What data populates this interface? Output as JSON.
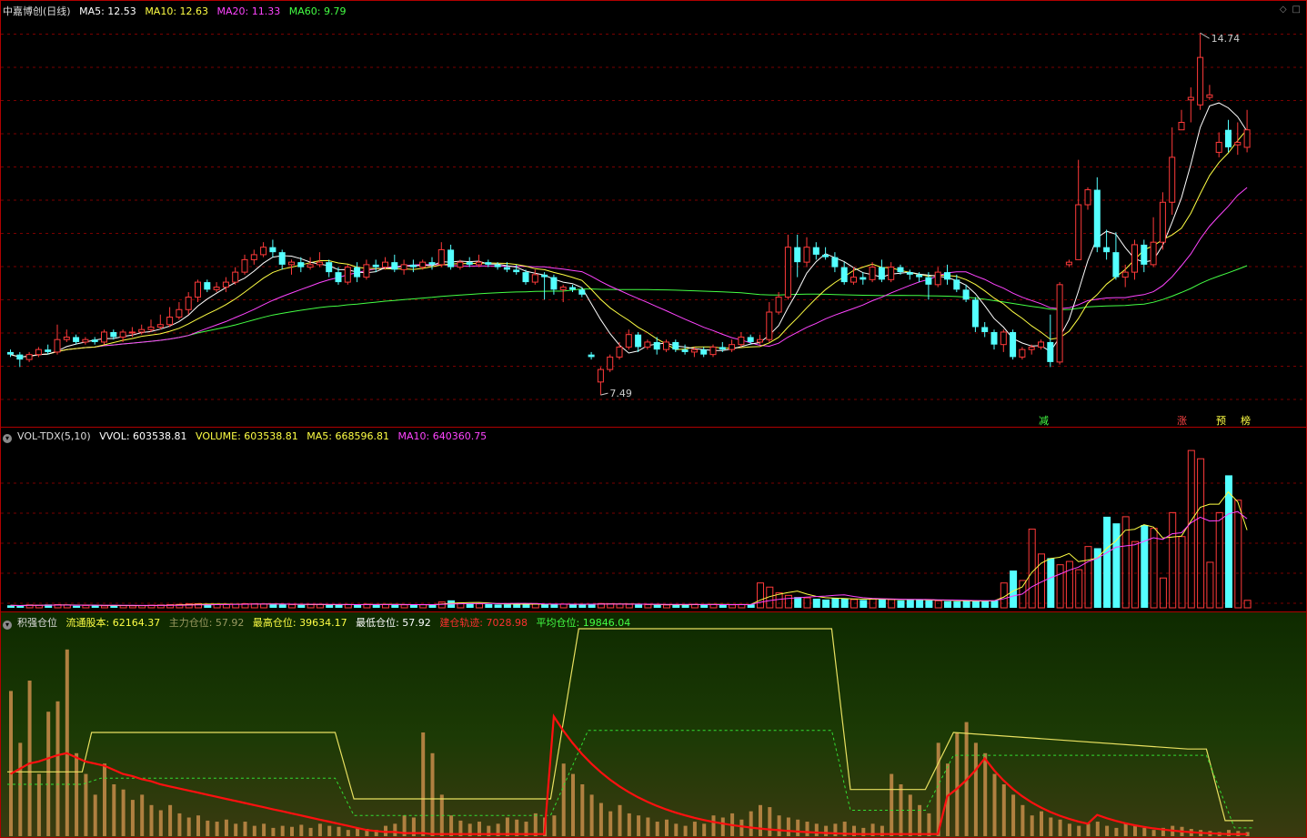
{
  "price": {
    "title": "中嘉博创(日线)",
    "ma": [
      {
        "label": "MA5: 12.53",
        "color": "#ffffff"
      },
      {
        "label": "MA10: 12.63",
        "color": "#ffff44"
      },
      {
        "label": "MA20: 11.33",
        "color": "#ff44ff"
      },
      {
        "label": "MA60: 9.79",
        "color": "#44ff44"
      }
    ],
    "high_label": "14.74",
    "low_label": "7.49",
    "signals": {
      "jian": "减",
      "zhang": "涨",
      "yu": "预",
      "bang": "榜"
    }
  },
  "volume": {
    "title": "VOL-TDX(5,10)",
    "vvol": "VVOL: 603538.81",
    "volume": "VOLUME: 603538.81",
    "ma5": "MA5: 668596.81",
    "ma10": "MA10: 640360.75"
  },
  "position": {
    "title": "积强仓位",
    "float_shares": "流通股本: 62164.37",
    "main_pos": "主力仓位: 57.92",
    "max_pos": "最高仓位: 39634.17",
    "min_pos": "最低仓位: 57.92",
    "build_track": "建仓轨迹: 7028.98",
    "avg_pos": "平均仓位: 19846.04"
  },
  "colors": {
    "up": "#ff3a3a",
    "down": "#54ffff",
    "grid": "#7a0000",
    "ma5": "#ffffff",
    "ma10": "#ffff44",
    "ma20": "#ff44ff",
    "ma60": "#44ff44"
  },
  "candles": [
    [
      8.35,
      8.3,
      8.4,
      8.25
    ],
    [
      8.3,
      8.2,
      8.35,
      8.05
    ],
    [
      8.2,
      8.3,
      8.35,
      8.15
    ],
    [
      8.3,
      8.4,
      8.45,
      8.25
    ],
    [
      8.4,
      8.35,
      8.5,
      8.3
    ],
    [
      8.35,
      8.6,
      8.9,
      8.3
    ],
    [
      8.6,
      8.65,
      8.8,
      8.55
    ],
    [
      8.65,
      8.55,
      8.7,
      8.5
    ],
    [
      8.55,
      8.6,
      8.65,
      8.5
    ],
    [
      8.6,
      8.55,
      8.65,
      8.5
    ],
    [
      8.55,
      8.75,
      8.8,
      8.5
    ],
    [
      8.75,
      8.65,
      8.8,
      8.6
    ],
    [
      8.65,
      8.75,
      8.8,
      8.55
    ],
    [
      8.75,
      8.75,
      8.85,
      8.65
    ],
    [
      8.75,
      8.8,
      8.9,
      8.7
    ],
    [
      8.8,
      8.85,
      9.0,
      8.75
    ],
    [
      8.85,
      8.9,
      9.1,
      8.8
    ],
    [
      8.9,
      9.05,
      9.25,
      8.85
    ],
    [
      9.05,
      9.2,
      9.35,
      9.0
    ],
    [
      9.2,
      9.45,
      9.55,
      9.1
    ],
    [
      9.45,
      9.75,
      9.8,
      9.35
    ],
    [
      9.75,
      9.6,
      9.8,
      9.55
    ],
    [
      9.6,
      9.65,
      9.75,
      9.55
    ],
    [
      9.65,
      9.75,
      9.85,
      9.55
    ],
    [
      9.75,
      9.95,
      10.05,
      9.7
    ],
    [
      9.95,
      10.2,
      10.3,
      9.9
    ],
    [
      10.2,
      10.3,
      10.4,
      10.1
    ],
    [
      10.3,
      10.45,
      10.55,
      10.25
    ],
    [
      10.45,
      10.35,
      10.6,
      10.25
    ],
    [
      10.35,
      10.1,
      10.4,
      10.0
    ],
    [
      10.1,
      10.15,
      10.2,
      9.9
    ],
    [
      10.15,
      10.05,
      10.25,
      9.95
    ],
    [
      10.05,
      10.1,
      10.25,
      10.0
    ],
    [
      10.1,
      10.15,
      10.35,
      10.05
    ],
    [
      10.15,
      9.95,
      10.2,
      9.85
    ],
    [
      9.95,
      9.75,
      10.05,
      9.7
    ],
    [
      9.75,
      10.05,
      10.1,
      9.7
    ],
    [
      10.05,
      9.85,
      10.15,
      9.75
    ],
    [
      9.85,
      10.1,
      10.2,
      9.8
    ],
    [
      10.1,
      10.05,
      10.2,
      9.95
    ],
    [
      10.05,
      10.15,
      10.25,
      10.0
    ],
    [
      10.15,
      10.0,
      10.3,
      9.95
    ],
    [
      10.0,
      10.1,
      10.2,
      9.9
    ],
    [
      10.1,
      10.05,
      10.2,
      9.95
    ],
    [
      10.05,
      10.15,
      10.2,
      10.0
    ],
    [
      10.15,
      10.1,
      10.25,
      10.0
    ],
    [
      10.1,
      10.4,
      10.55,
      10.05
    ],
    [
      10.4,
      10.05,
      10.5,
      10.0
    ],
    [
      10.05,
      10.15,
      10.2,
      10.0
    ],
    [
      10.15,
      10.1,
      10.25,
      10.05
    ],
    [
      10.1,
      10.15,
      10.3,
      10.05
    ],
    [
      10.15,
      10.1,
      10.2,
      10.05
    ],
    [
      10.1,
      10.05,
      10.15,
      10.0
    ],
    [
      10.05,
      10.0,
      10.15,
      9.95
    ],
    [
      10.0,
      9.95,
      10.1,
      9.9
    ],
    [
      9.95,
      9.75,
      10.0,
      9.7
    ],
    [
      9.75,
      9.9,
      10.0,
      9.7
    ],
    [
      9.9,
      9.85,
      9.95,
      9.4
    ],
    [
      9.85,
      9.6,
      9.9,
      9.5
    ],
    [
      9.6,
      9.65,
      9.7,
      9.35
    ],
    [
      9.65,
      9.6,
      9.7,
      9.55
    ],
    [
      9.6,
      9.5,
      9.65,
      9.45
    ],
    [
      8.3,
      8.25,
      8.35,
      8.2
    ],
    [
      7.75,
      8.0,
      8.05,
      7.49
    ],
    [
      8.0,
      8.25,
      8.3,
      7.95
    ],
    [
      8.25,
      8.45,
      8.55,
      8.2
    ],
    [
      8.45,
      8.7,
      8.8,
      8.4
    ],
    [
      8.7,
      8.45,
      8.75,
      8.35
    ],
    [
      8.45,
      8.55,
      8.6,
      8.4
    ],
    [
      8.55,
      8.4,
      8.65,
      8.3
    ],
    [
      8.4,
      8.55,
      8.6,
      8.35
    ],
    [
      8.55,
      8.4,
      8.6,
      8.35
    ],
    [
      8.4,
      8.35,
      8.5,
      8.3
    ],
    [
      8.35,
      8.4,
      8.45,
      8.25
    ],
    [
      8.4,
      8.3,
      8.45,
      8.25
    ],
    [
      8.3,
      8.45,
      8.5,
      8.25
    ],
    [
      8.45,
      8.4,
      8.55,
      8.35
    ],
    [
      8.4,
      8.5,
      8.6,
      8.35
    ],
    [
      8.5,
      8.65,
      8.75,
      8.45
    ],
    [
      8.65,
      8.55,
      8.7,
      8.5
    ],
    [
      8.55,
      8.6,
      8.7,
      8.5
    ],
    [
      8.6,
      9.15,
      9.35,
      8.55
    ],
    [
      9.15,
      9.45,
      9.55,
      9.1
    ],
    [
      9.45,
      10.45,
      10.7,
      9.4
    ],
    [
      10.45,
      10.15,
      10.7,
      9.85
    ],
    [
      10.15,
      10.45,
      10.65,
      10.05
    ],
    [
      10.45,
      10.3,
      10.55,
      10.2
    ],
    [
      10.3,
      10.25,
      10.45,
      10.2
    ],
    [
      10.25,
      10.05,
      10.35,
      9.95
    ],
    [
      10.05,
      9.75,
      10.15,
      9.7
    ],
    [
      9.75,
      9.85,
      10.05,
      9.7
    ],
    [
      9.85,
      9.8,
      9.95,
      9.7
    ],
    [
      9.8,
      10.05,
      10.15,
      9.75
    ],
    [
      10.05,
      9.8,
      10.2,
      9.75
    ],
    [
      9.8,
      10.05,
      10.15,
      9.75
    ],
    [
      10.05,
      9.95,
      10.1,
      9.9
    ],
    [
      9.95,
      9.9,
      10.0,
      9.8
    ],
    [
      9.9,
      9.85,
      9.95,
      9.75
    ],
    [
      9.85,
      9.7,
      9.95,
      9.4
    ],
    [
      9.7,
      9.95,
      10.05,
      9.65
    ],
    [
      9.95,
      9.8,
      10.1,
      9.7
    ],
    [
      9.8,
      9.6,
      9.9,
      9.55
    ],
    [
      9.6,
      9.4,
      9.7,
      9.35
    ],
    [
      9.4,
      8.85,
      9.45,
      8.75
    ],
    [
      8.85,
      8.75,
      8.95,
      8.65
    ],
    [
      8.75,
      8.5,
      8.8,
      8.4
    ],
    [
      8.5,
      8.75,
      8.8,
      8.35
    ],
    [
      8.75,
      8.25,
      8.8,
      8.2
    ],
    [
      8.25,
      8.4,
      8.45,
      8.2
    ],
    [
      8.4,
      8.45,
      8.5,
      8.3
    ],
    [
      8.45,
      8.55,
      8.6,
      8.4
    ],
    [
      8.55,
      8.15,
      9.1,
      8.05
    ],
    [
      8.15,
      9.7,
      9.75,
      8.1
    ],
    [
      10.1,
      10.15,
      10.2,
      10.05
    ],
    [
      10.2,
      11.3,
      12.2,
      10.55
    ],
    [
      11.3,
      11.6,
      11.65,
      11.2
    ],
    [
      11.6,
      10.45,
      11.85,
      10.35
    ],
    [
      10.45,
      10.35,
      10.8,
      10.2
    ],
    [
      10.35,
      9.85,
      10.75,
      9.8
    ],
    [
      9.85,
      9.95,
      10.1,
      9.65
    ],
    [
      9.95,
      10.5,
      10.6,
      9.8
    ],
    [
      10.5,
      10.1,
      10.6,
      9.95
    ],
    [
      10.1,
      10.55,
      11.05,
      10.05
    ],
    [
      10.55,
      11.35,
      11.55,
      10.4
    ],
    [
      11.35,
      12.25,
      12.85,
      11.1
    ],
    [
      12.8,
      12.95,
      13.2,
      12.85
    ],
    [
      13.4,
      13.45,
      13.65,
      12.95
    ],
    [
      13.3,
      14.25,
      14.74,
      13.2
    ],
    [
      13.45,
      13.5,
      13.7,
      13.4
    ],
    [
      12.35,
      12.55,
      12.75,
      12.25
    ],
    [
      12.8,
      12.45,
      13.0,
      12.35
    ],
    [
      12.5,
      12.55,
      12.95,
      12.3
    ],
    [
      12.45,
      12.8,
      13.2,
      12.35
    ]
  ],
  "volumes": [
    30,
    26,
    35,
    30,
    40,
    38,
    34,
    25,
    28,
    32,
    24,
    30,
    26,
    24,
    28,
    32,
    34,
    38,
    42,
    48,
    50,
    45,
    42,
    40,
    44,
    50,
    48,
    46,
    42,
    40,
    38,
    36,
    40,
    42,
    38,
    36,
    40,
    38,
    44,
    42,
    40,
    38,
    36,
    34,
    40,
    38,
    70,
    90,
    60,
    55,
    48,
    44,
    40,
    42,
    46,
    48,
    44,
    40,
    42,
    46,
    44,
    40,
    46,
    52,
    48,
    44,
    42,
    40,
    38,
    36,
    34,
    38,
    40,
    42,
    44,
    40,
    38,
    36,
    40,
    42,
    300,
    250,
    180,
    150,
    130,
    120,
    110,
    100,
    120,
    110,
    100,
    95,
    105,
    110,
    100,
    90,
    95,
    100,
    90,
    85,
    80,
    78,
    82,
    80,
    88,
    90,
    300,
    450,
    330,
    950,
    650,
    600,
    520,
    560,
    460,
    740,
    720,
    1100,
    1020,
    1100,
    800,
    1000,
    960,
    360,
    1150,
    860,
    1900,
    1800,
    550,
    1150,
    1600,
    1300,
    90
  ],
  "pos_bars": [
    140,
    90,
    150,
    60,
    120,
    130,
    180,
    80,
    60,
    40,
    70,
    50,
    45,
    35,
    40,
    30,
    25,
    30,
    22,
    18,
    20,
    15,
    14,
    16,
    12,
    14,
    10,
    12,
    8,
    10,
    9,
    11,
    8,
    12,
    10,
    9,
    6,
    8,
    7,
    6,
    10,
    12,
    20,
    18,
    100,
    80,
    40,
    20,
    15,
    12,
    14,
    10,
    12,
    18,
    16,
    14,
    22,
    18,
    20,
    70,
    60,
    50,
    40,
    32,
    24,
    30,
    22,
    20,
    18,
    14,
    16,
    12,
    10,
    14,
    12,
    20,
    18,
    22,
    16,
    24,
    30,
    28,
    20,
    18,
    16,
    14,
    12,
    10,
    12,
    14,
    10,
    8,
    12,
    10,
    60,
    50,
    40,
    30,
    22,
    90,
    70,
    100,
    110,
    90,
    80,
    60,
    50,
    40,
    30,
    20,
    24,
    18,
    16,
    12,
    10,
    12,
    14,
    10,
    8,
    12,
    10,
    8,
    6,
    8,
    10,
    9,
    7,
    6,
    5,
    4,
    6,
    5,
    4,
    3
  ],
  "pos_avg": [
    50,
    60,
    64,
    66,
    66,
    70,
    72,
    68,
    64,
    62,
    60,
    56,
    54,
    52,
    50,
    49,
    48,
    47,
    46,
    45,
    44,
    44,
    43,
    42,
    41,
    40,
    39,
    38,
    37,
    36,
    35,
    35,
    34,
    34,
    33,
    33,
    32,
    32,
    31,
    31,
    30,
    30,
    29,
    28,
    28,
    27,
    27,
    26,
    25,
    25,
    24,
    24,
    23,
    23,
    22,
    22,
    22,
    21,
    21,
    20,
    20,
    19,
    19,
    18,
    18,
    18,
    17,
    17,
    16,
    16,
    16,
    15,
    15,
    15,
    14,
    14,
    14,
    13,
    13,
    13,
    12,
    12,
    12,
    12,
    12,
    12,
    11,
    11,
    11,
    11,
    11,
    11,
    11,
    11,
    11,
    10,
    10,
    10,
    10,
    10,
    10,
    10,
    10,
    10,
    10,
    10,
    10,
    10,
    10,
    10,
    10,
    10,
    10,
    10,
    10,
    10,
    10,
    10,
    10,
    10,
    10,
    10,
    10,
    10,
    10,
    10,
    10,
    10,
    10,
    10,
    10,
    10,
    10,
    10
  ],
  "pos_red": [
    60,
    65,
    70,
    72,
    75,
    78,
    80,
    76,
    72,
    70,
    68,
    64,
    60,
    58,
    55,
    53,
    50,
    48,
    46,
    44,
    42,
    40,
    38,
    36,
    34,
    32,
    30,
    28,
    26,
    24,
    22,
    20,
    18,
    16,
    14,
    12,
    10,
    8,
    6,
    5,
    4,
    4,
    3,
    3,
    3,
    2,
    2,
    2,
    2,
    2,
    2,
    2,
    2,
    2,
    2,
    2,
    2,
    2,
    2,
    2,
    2,
    2,
    2,
    2,
    2,
    2,
    2,
    2,
    2,
    2,
    2,
    2,
    2,
    2,
    2,
    2,
    2,
    2,
    2,
    2,
    2,
    2,
    2,
    2,
    2,
    2,
    2,
    2,
    2,
    2,
    2,
    2,
    2,
    2,
    2,
    2,
    2,
    2,
    2,
    2,
    2,
    2,
    2,
    2,
    2,
    2,
    2,
    2,
    2,
    2,
    2,
    2,
    2,
    2,
    2,
    2,
    2,
    2,
    2,
    2,
    2,
    2,
    2,
    2,
    2,
    2,
    2,
    2,
    2,
    2,
    2,
    2,
    2
  ]
}
